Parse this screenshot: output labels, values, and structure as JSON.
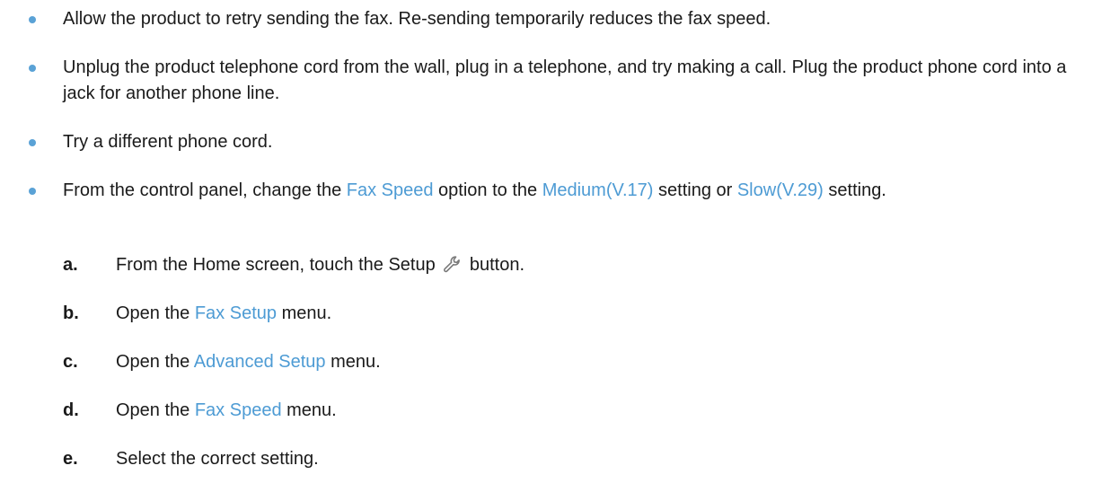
{
  "bullets": [
    {
      "text": "Allow the product to retry sending the fax. Re-sending temporarily reduces the fax speed."
    },
    {
      "text": "Unplug the product telephone cord from the wall, plug in a telephone, and try making a call. Plug the product phone cord into a jack for another phone line."
    },
    {
      "text": "Try a different phone cord."
    },
    {
      "part1": "From the control panel, change the ",
      "link1": "Fax Speed",
      "part2": " option to the ",
      "link2": "Medium(V.17)",
      "part3": " setting or ",
      "link3": "Slow(V.29)",
      "part4": " setting."
    }
  ],
  "steps": [
    {
      "letter": "a.",
      "before": "From the Home screen, touch the Setup ",
      "after": " button.",
      "icon": "wrench-icon"
    },
    {
      "letter": "b.",
      "before": "Open the ",
      "link": "Fax Setup",
      "after": " menu."
    },
    {
      "letter": "c.",
      "before": "Open the ",
      "link": "Advanced Setup",
      "after": " menu."
    },
    {
      "letter": "d.",
      "before": "Open the ",
      "link": "Fax Speed",
      "after": " menu."
    },
    {
      "letter": "e.",
      "text": "Select the correct setting."
    }
  ],
  "colors": {
    "accent": "#4d9bd4",
    "bullet": "#5aa2d6",
    "text": "#1a1a1a"
  }
}
